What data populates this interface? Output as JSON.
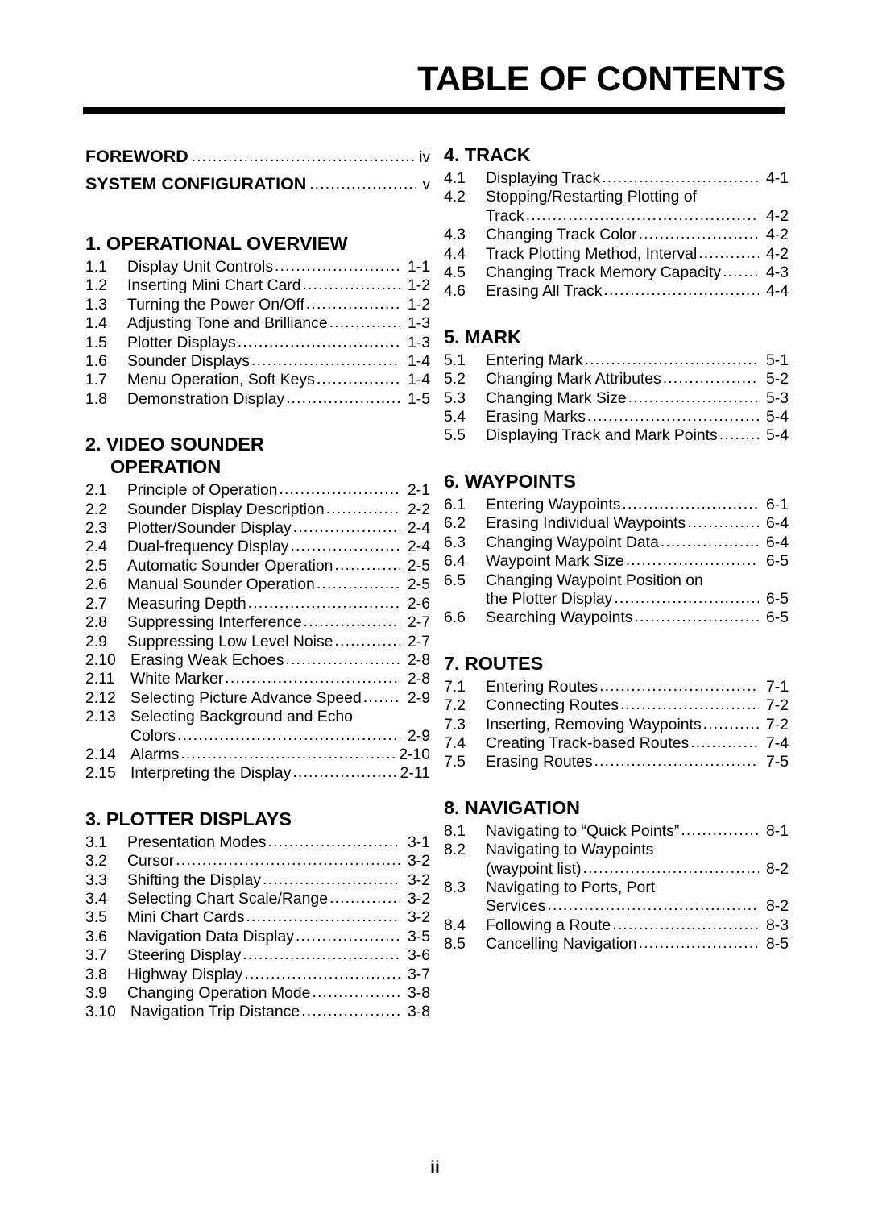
{
  "page": {
    "title": "TABLE OF CONTENTS",
    "folio": "ii"
  },
  "front_matter": [
    {
      "label": "FOREWORD",
      "page": "iv"
    },
    {
      "label": "SYSTEM CONFIGURATION",
      "page": "v"
    }
  ],
  "left_column": {
    "sections": [
      {
        "heading": "1. OPERATIONAL OVERVIEW",
        "heading_lines": [
          "1. OPERATIONAL OVERVIEW"
        ],
        "entries": [
          {
            "num": "1.1",
            "title": "Display Unit Controls",
            "page": "1-1"
          },
          {
            "num": "1.2",
            "title": "Inserting Mini Chart Card",
            "page": "1-2"
          },
          {
            "num": "1.3",
            "title": "Turning the Power On/Off",
            "page": "1-2"
          },
          {
            "num": "1.4",
            "title": "Adjusting Tone and Brilliance",
            "page": "1-3"
          },
          {
            "num": "1.5",
            "title": "Plotter Displays",
            "page": "1-3"
          },
          {
            "num": "1.6",
            "title": "Sounder Displays",
            "page": "1-4"
          },
          {
            "num": "1.7",
            "title": "Menu Operation, Soft Keys",
            "page": "1-4"
          },
          {
            "num": "1.8",
            "title": "Demonstration Display",
            "page": "1-5"
          }
        ]
      },
      {
        "heading": "2. VIDEO SOUNDER OPERATION",
        "heading_lines": [
          "2. VIDEO SOUNDER",
          "OPERATION"
        ],
        "entries": [
          {
            "num": "2.1",
            "title": "Principle of Operation",
            "page": "2-1"
          },
          {
            "num": "2.2",
            "title": "Sounder Display Description",
            "page": "2-2"
          },
          {
            "num": "2.3",
            "title": "Plotter/Sounder Display",
            "page": "2-4"
          },
          {
            "num": "2.4",
            "title": "Dual-frequency Display",
            "page": "2-4"
          },
          {
            "num": "2.5",
            "title": "Automatic Sounder Operation",
            "page": "2-5"
          },
          {
            "num": "2.6",
            "title": "Manual Sounder Operation",
            "page": "2-5"
          },
          {
            "num": "2.7",
            "title": "Measuring Depth",
            "page": "2-6"
          },
          {
            "num": "2.8",
            "title": "Suppressing Interference",
            "page": "2-7"
          },
          {
            "num": "2.9",
            "title": "Suppressing Low Level Noise",
            "page": "2-7"
          },
          {
            "num": "2.10",
            "title": "Erasing Weak Echoes",
            "page": "2-8",
            "wide": true
          },
          {
            "num": "2.11",
            "title": "White Marker",
            "page": "2-8",
            "wide": true
          },
          {
            "num": "2.12",
            "title": "Selecting Picture Advance Speed",
            "page": "2-9",
            "wide": true
          },
          {
            "num": "2.13",
            "title": "Selecting Background and Echo",
            "title_cont": "Colors",
            "page": "2-9",
            "wide": true
          },
          {
            "num": "2.14",
            "title": "Alarms",
            "page": "2-10",
            "wide": true
          },
          {
            "num": "2.15",
            "title": "Interpreting the Display",
            "page": "2-11",
            "wide": true
          }
        ]
      },
      {
        "heading": "3. PLOTTER DISPLAYS",
        "heading_lines": [
          "3. PLOTTER DISPLAYS"
        ],
        "entries": [
          {
            "num": "3.1",
            "title": "Presentation Modes",
            "page": "3-1"
          },
          {
            "num": "3.2",
            "title": "Cursor",
            "page": "3-2"
          },
          {
            "num": "3.3",
            "title": "Shifting the Display",
            "page": "3-2"
          },
          {
            "num": "3.4",
            "title": "Selecting Chart Scale/Range",
            "page": "3-2"
          },
          {
            "num": "3.5",
            "title": "Mini Chart Cards",
            "page": "3-2"
          },
          {
            "num": "3.6",
            "title": "Navigation Data Display",
            "page": "3-5"
          },
          {
            "num": "3.7",
            "title": "Steering Display",
            "page": "3-6"
          },
          {
            "num": "3.8",
            "title": "Highway Display",
            "page": "3-7"
          },
          {
            "num": "3.9",
            "title": "Changing Operation Mode",
            "page": "3-8"
          },
          {
            "num": "3.10",
            "title": "Navigation Trip Distance",
            "page": "3-8",
            "wide": true
          }
        ]
      }
    ]
  },
  "right_column": {
    "sections": [
      {
        "heading": "4. TRACK",
        "heading_lines": [
          "4. TRACK"
        ],
        "entries": [
          {
            "num": "4.1",
            "title": "Displaying Track",
            "page": "4-1"
          },
          {
            "num": "4.2",
            "title": "Stopping/Restarting Plotting of",
            "title_cont": "Track",
            "page": "4-2"
          },
          {
            "num": "4.3",
            "title": "Changing Track Color",
            "page": "4-2"
          },
          {
            "num": "4.4",
            "title": "Track Plotting Method, Interval",
            "page": "4-2"
          },
          {
            "num": "4.5",
            "title": "Changing Track Memory Capacity",
            "page": "4-3"
          },
          {
            "num": "4.6",
            "title": "Erasing All Track",
            "page": "4-4"
          }
        ]
      },
      {
        "heading": "5. MARK",
        "heading_lines": [
          "5. MARK"
        ],
        "entries": [
          {
            "num": "5.1",
            "title": "Entering Mark",
            "page": "5-1"
          },
          {
            "num": "5.2",
            "title": "Changing Mark Attributes",
            "page": "5-2"
          },
          {
            "num": "5.3",
            "title": "Changing Mark Size",
            "page": "5-3"
          },
          {
            "num": "5.4",
            "title": "Erasing Marks",
            "page": "5-4"
          },
          {
            "num": "5.5",
            "title": "Displaying Track and Mark Points",
            "page": "5-4"
          }
        ]
      },
      {
        "heading": "6. WAYPOINTS",
        "heading_lines": [
          "6. WAYPOINTS"
        ],
        "entries": [
          {
            "num": "6.1",
            "title": "Entering Waypoints",
            "page": "6-1"
          },
          {
            "num": "6.2",
            "title": "Erasing Individual Waypoints",
            "page": "6-4"
          },
          {
            "num": "6.3",
            "title": "Changing Waypoint Data",
            "page": "6-4"
          },
          {
            "num": "6.4",
            "title": "Waypoint Mark Size",
            "page": "6-5"
          },
          {
            "num": "6.5",
            "title": "Changing Waypoint Position on",
            "title_cont": "the Plotter Display",
            "page": "6-5"
          },
          {
            "num": "6.6",
            "title": "Searching Waypoints",
            "page": "6-5"
          }
        ]
      },
      {
        "heading": "7. ROUTES",
        "heading_lines": [
          "7. ROUTES"
        ],
        "entries": [
          {
            "num": "7.1",
            "title": "Entering Routes",
            "page": "7-1"
          },
          {
            "num": "7.2",
            "title": "Connecting Routes",
            "page": "7-2"
          },
          {
            "num": "7.3",
            "title": "Inserting, Removing Waypoints",
            "page": "7-2"
          },
          {
            "num": "7.4",
            "title": "Creating Track-based Routes",
            "page": "7-4"
          },
          {
            "num": "7.5",
            "title": "Erasing Routes",
            "page": "7-5"
          }
        ]
      },
      {
        "heading": "8. NAVIGATION",
        "heading_lines": [
          "8. NAVIGATION"
        ],
        "entries": [
          {
            "num": "8.1",
            "title": "Navigating to “Quick Points”",
            "page": "8-1"
          },
          {
            "num": "8.2",
            "title": "Navigating to Waypoints",
            "title_cont": "(waypoint list)",
            "page": "8-2"
          },
          {
            "num": "8.3",
            "title": "Navigating to Ports, Port",
            "title_cont": "Services",
            "page": "8-2"
          },
          {
            "num": "8.4",
            "title": "Following a Route",
            "page": "8-3"
          },
          {
            "num": "8.5",
            "title": "Cancelling Navigation",
            "page": "8-5"
          }
        ]
      }
    ]
  },
  "leader_dot": "."
}
